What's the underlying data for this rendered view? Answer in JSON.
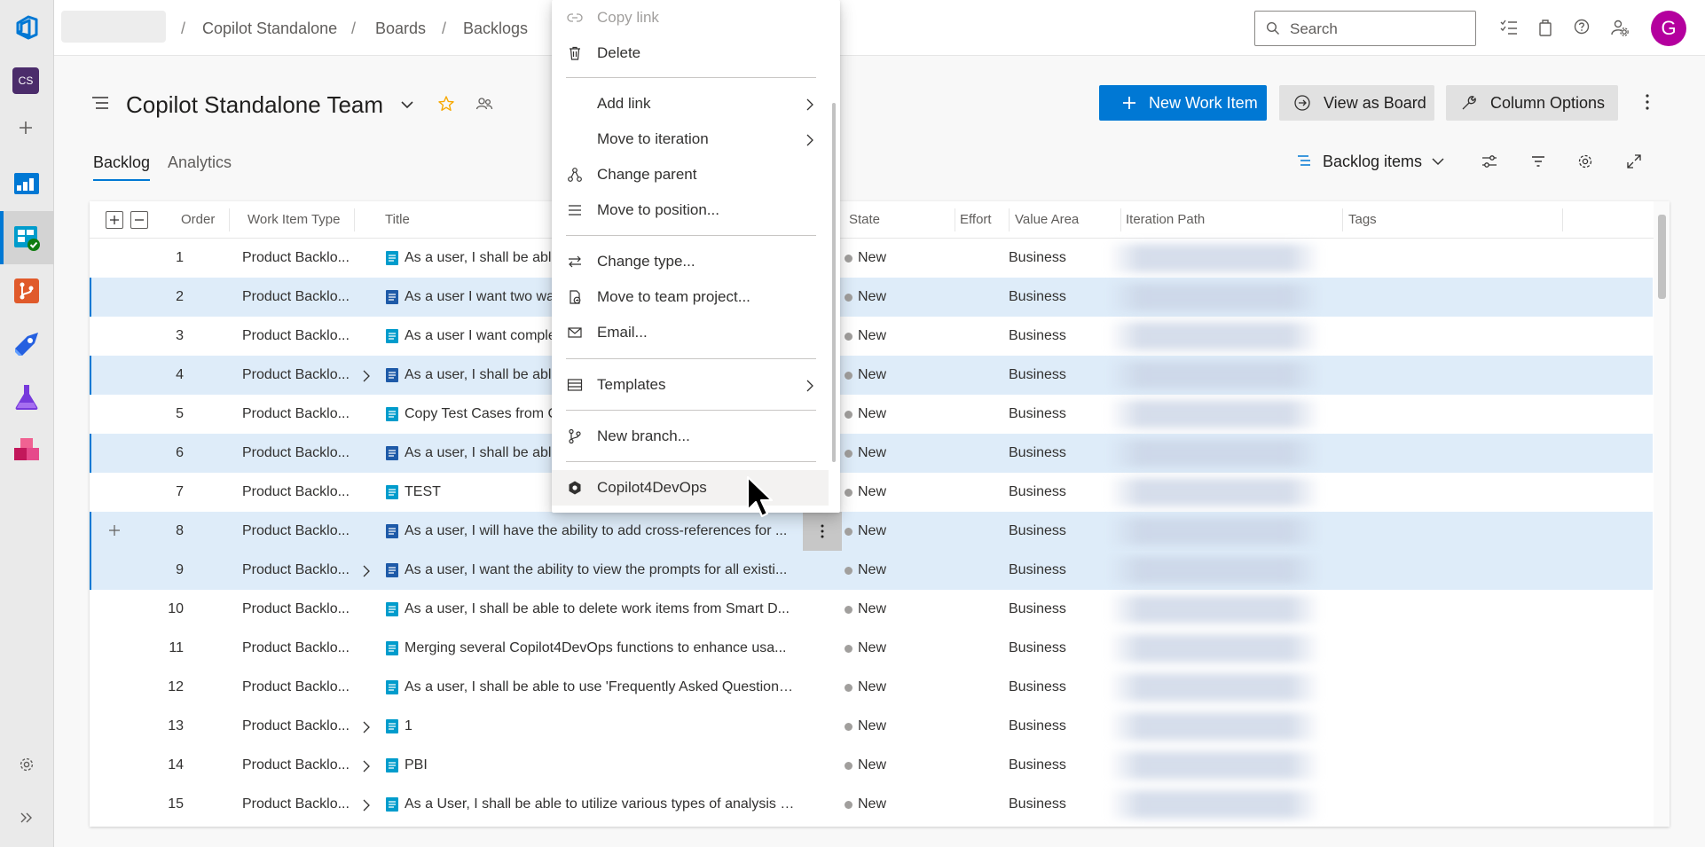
{
  "breadcrumbs": [
    "Copilot Standalone",
    "Boards",
    "Backlogs"
  ],
  "search": {
    "placeholder": "Search"
  },
  "avatar_initial": "G",
  "project_badge": "CS",
  "team_title": "Copilot Standalone Team",
  "buttons": {
    "new_work_item": "New Work Item",
    "view_as_board": "View as Board",
    "column_options": "Column Options"
  },
  "tabs": [
    "Backlog",
    "Analytics"
  ],
  "backlog_level": "Backlog items",
  "columns": [
    "Order",
    "Work Item Type",
    "Title",
    "State",
    "Effort",
    "Value Area",
    "Iteration Path",
    "Tags"
  ],
  "rows": [
    {
      "order": "1",
      "type": "Product Backlo...",
      "title": "As a user, I shall be able",
      "state": "New",
      "area": "Business"
    },
    {
      "order": "2",
      "type": "Product Backlo...",
      "title": "As a user I want two wa",
      "state": "New",
      "area": "Business"
    },
    {
      "order": "3",
      "type": "Product Backlo...",
      "title": "As a user I want comple",
      "state": "New",
      "area": "Business"
    },
    {
      "order": "4",
      "type": "Product Backlo...",
      "title": "As a user, I shall be able",
      "state": "New",
      "area": "Business"
    },
    {
      "order": "5",
      "type": "Product Backlo...",
      "title": "Copy Test Cases from C",
      "state": "New",
      "area": "Business"
    },
    {
      "order": "6",
      "type": "Product Backlo...",
      "title": "As a user, I shall be able",
      "state": "New",
      "area": "Business"
    },
    {
      "order": "7",
      "type": "Product Backlo...",
      "title": "TEST",
      "state": "New",
      "area": "Business"
    },
    {
      "order": "8",
      "type": "Product Backlo...",
      "title": "As a user, I will have the ability to add cross-references for ...",
      "state": "New",
      "area": "Business"
    },
    {
      "order": "9",
      "type": "Product Backlo...",
      "title": "As a user, I want the ability to view the prompts for all existi...",
      "state": "New",
      "area": "Business"
    },
    {
      "order": "10",
      "type": "Product Backlo...",
      "title": "As a user, I shall be able to delete work items from Smart D...",
      "state": "New",
      "area": "Business"
    },
    {
      "order": "11",
      "type": "Product Backlo...",
      "title": "Merging several Copilot4DevOps functions to enhance usa...",
      "state": "New",
      "area": "Business"
    },
    {
      "order": "12",
      "type": "Product Backlo...",
      "title": "As a user, I shall be able to use 'Frequently Asked Questions...",
      "state": "New",
      "area": "Business"
    },
    {
      "order": "13",
      "type": "Product Backlo...",
      "title": "1",
      "state": "New",
      "area": "Business"
    },
    {
      "order": "14",
      "type": "Product Backlo...",
      "title": "PBI",
      "state": "New",
      "area": "Business"
    },
    {
      "order": "15",
      "type": "Product Backlo...",
      "title": "As a User, I shall be able to utilize various types of analysis -...",
      "state": "New",
      "area": "Business"
    }
  ],
  "context_menu": [
    "Copy link",
    "Delete",
    "Add link",
    "Move to iteration",
    "Change parent",
    "Move to position...",
    "Change type...",
    "Move to team project...",
    "Email...",
    "Templates",
    "New branch...",
    "Copilot4DevOps"
  ],
  "colors": {
    "accent": "#0078d4",
    "selected_row": "#deecf9",
    "avatar": "#b4009e"
  }
}
